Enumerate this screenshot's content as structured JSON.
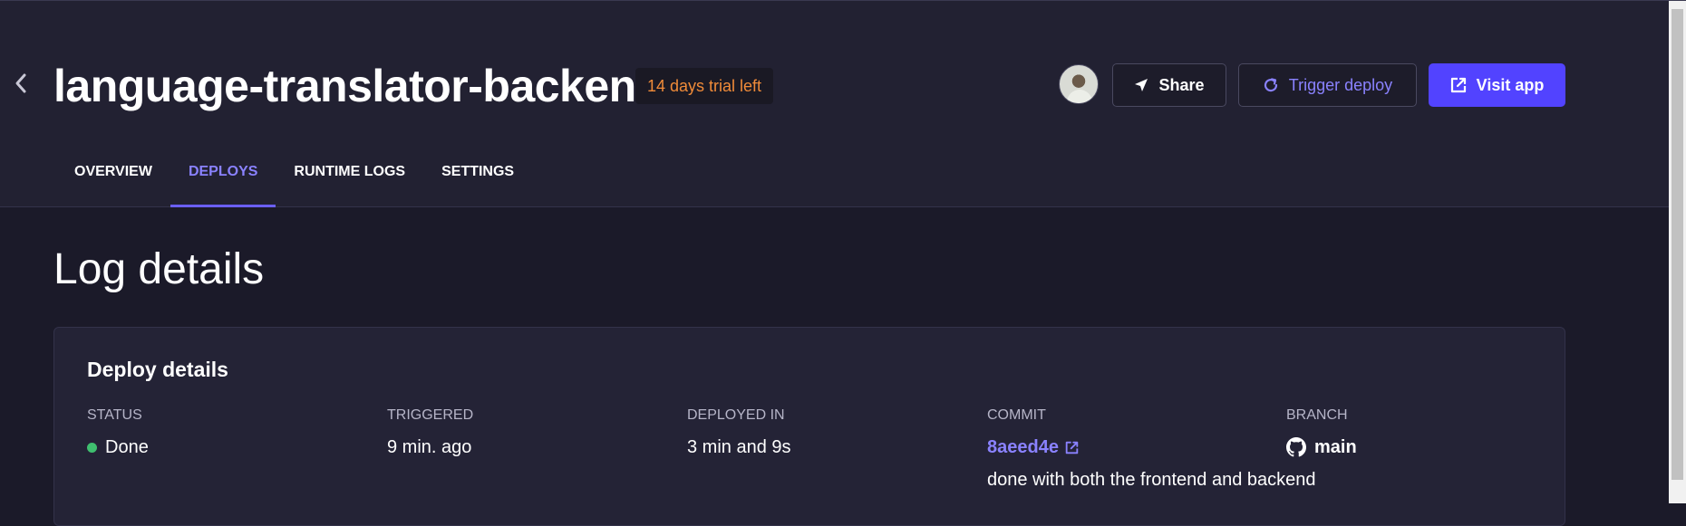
{
  "header": {
    "back_icon": "chevron-left-icon",
    "title": "language-translator-backend",
    "trial_badge": "14 days trial left",
    "share_icon": "send-icon",
    "share_label": "Share",
    "trigger_icon": "refresh-icon",
    "trigger_label": "Trigger deploy",
    "visit_icon": "external-link-icon",
    "visit_label": "Visit app"
  },
  "tabs": [
    {
      "label": "OVERVIEW",
      "active": false
    },
    {
      "label": "DEPLOYS",
      "active": true
    },
    {
      "label": "RUNTIME LOGS",
      "active": false
    },
    {
      "label": "SETTINGS",
      "active": false
    }
  ],
  "main": {
    "page_title": "Log details",
    "card": {
      "title": "Deploy details",
      "status": {
        "label": "STATUS",
        "value": "Done",
        "status_color": "#3fbf6f"
      },
      "triggered": {
        "label": "TRIGGERED",
        "value": "9 min. ago"
      },
      "deployed_in": {
        "label": "DEPLOYED IN",
        "value": "3 min and 9s"
      },
      "commit": {
        "label": "COMMIT",
        "hash": "8aeed4e",
        "message": "done with both the frontend and backend"
      },
      "branch": {
        "label": "BRANCH",
        "icon": "github-icon",
        "value": "main"
      }
    }
  },
  "colors": {
    "accent": "#5243ff",
    "accent_text": "#8a82ff",
    "trial_text": "#f08b39",
    "header_bg": "#222132",
    "page_bg": "#1b1a29"
  }
}
